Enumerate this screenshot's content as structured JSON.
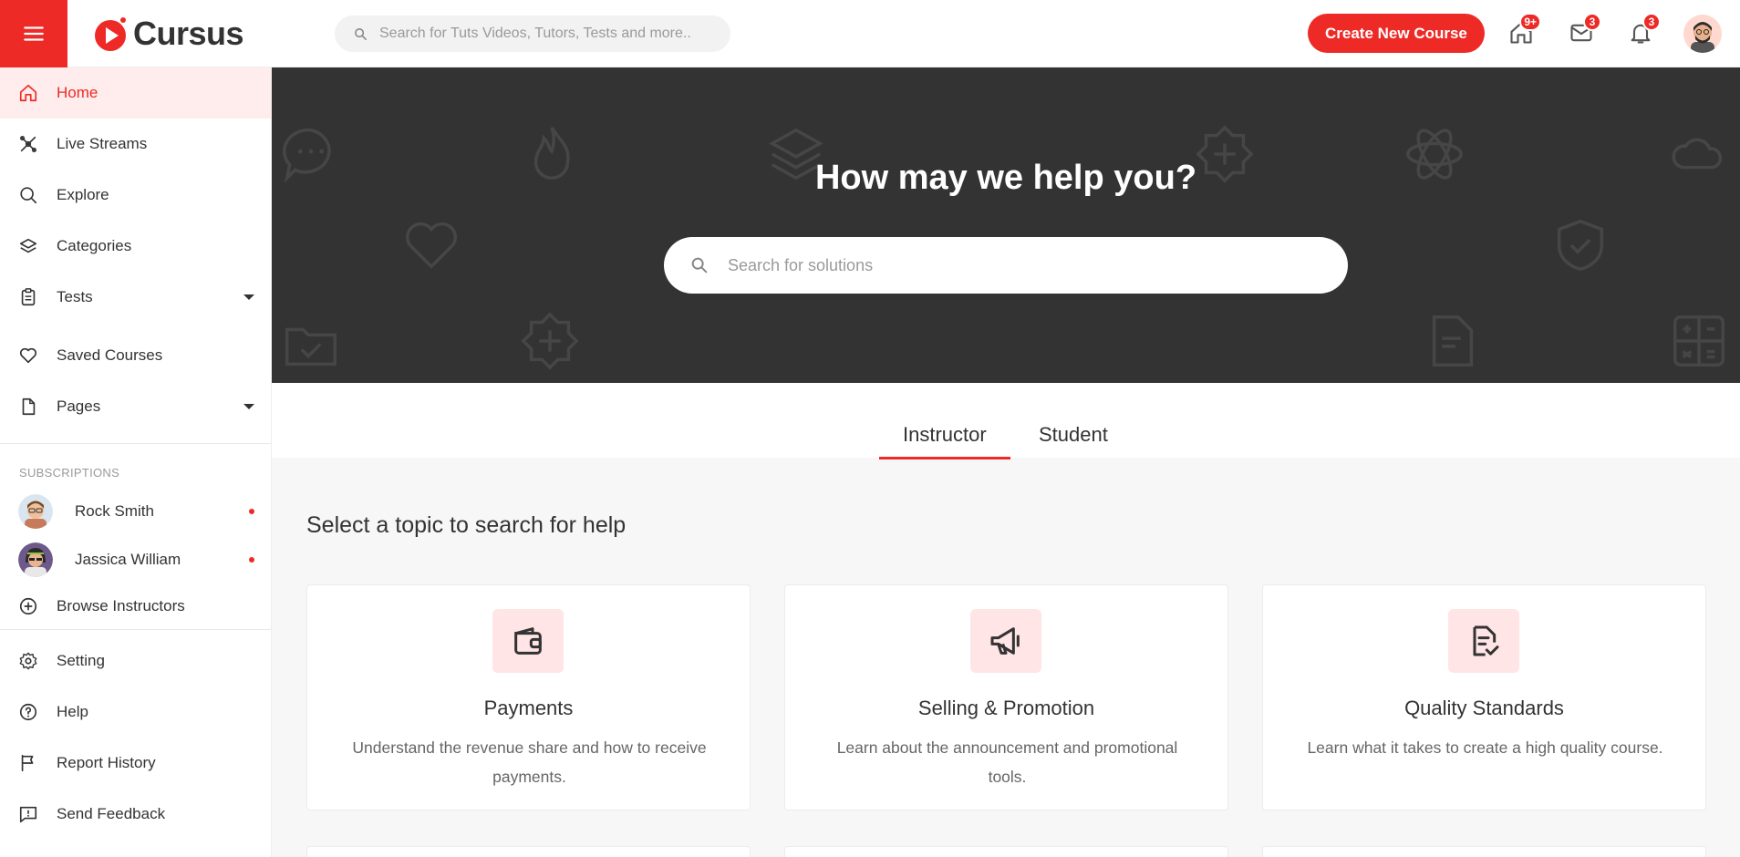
{
  "app": {
    "name": "Cursus"
  },
  "colors": {
    "accent": "#ed2a26",
    "hero_bg": "#333333",
    "icon_tint": "#ffe5e5"
  },
  "header": {
    "search_placeholder": "Search for Tuts Videos, Tutors, Tests and more..",
    "create_button": "Create New Course",
    "icons": [
      {
        "name": "home-icon",
        "badge": "9+"
      },
      {
        "name": "mail-icon",
        "badge": "3"
      },
      {
        "name": "bell-icon",
        "badge": "3"
      }
    ]
  },
  "sidebar": {
    "items": [
      {
        "label": "Home",
        "icon": "home-icon",
        "active": true
      },
      {
        "label": "Live Streams",
        "icon": "live-stream-icon"
      },
      {
        "label": "Explore",
        "icon": "search-icon"
      },
      {
        "label": "Categories",
        "icon": "layers-icon"
      },
      {
        "label": "Tests",
        "icon": "clipboard-icon",
        "dropdown": true
      },
      {
        "label": "Saved Courses",
        "icon": "heart-icon"
      },
      {
        "label": "Pages",
        "icon": "file-icon",
        "dropdown": true
      }
    ],
    "subscriptions_heading": "SUBSCRIPTIONS",
    "subscriptions": [
      {
        "name": "Rock Smith"
      },
      {
        "name": "Jassica William"
      }
    ],
    "browse_instructors": "Browse Instructors",
    "bottom_items": [
      {
        "label": "Setting",
        "icon": "gear-icon"
      },
      {
        "label": "Help",
        "icon": "help-icon"
      },
      {
        "label": "Report History",
        "icon": "flag-icon"
      },
      {
        "label": "Send Feedback",
        "icon": "feedback-icon"
      }
    ]
  },
  "hero": {
    "title": "How may we help you?",
    "search_placeholder": "Search for solutions"
  },
  "tabs": [
    {
      "label": "Instructor",
      "active": true
    },
    {
      "label": "Student"
    }
  ],
  "main": {
    "section_title": "Select a topic to search for help",
    "cards": [
      {
        "icon": "wallet-icon",
        "title": "Payments",
        "description": "Understand the revenue share and how to receive payments."
      },
      {
        "icon": "megaphone-icon",
        "title": "Selling & Promotion",
        "description": "Learn about the announcement and promotional tools."
      },
      {
        "icon": "checklist-icon",
        "title": "Quality Standards",
        "description": "Learn what it takes to create a high quality course."
      }
    ]
  }
}
